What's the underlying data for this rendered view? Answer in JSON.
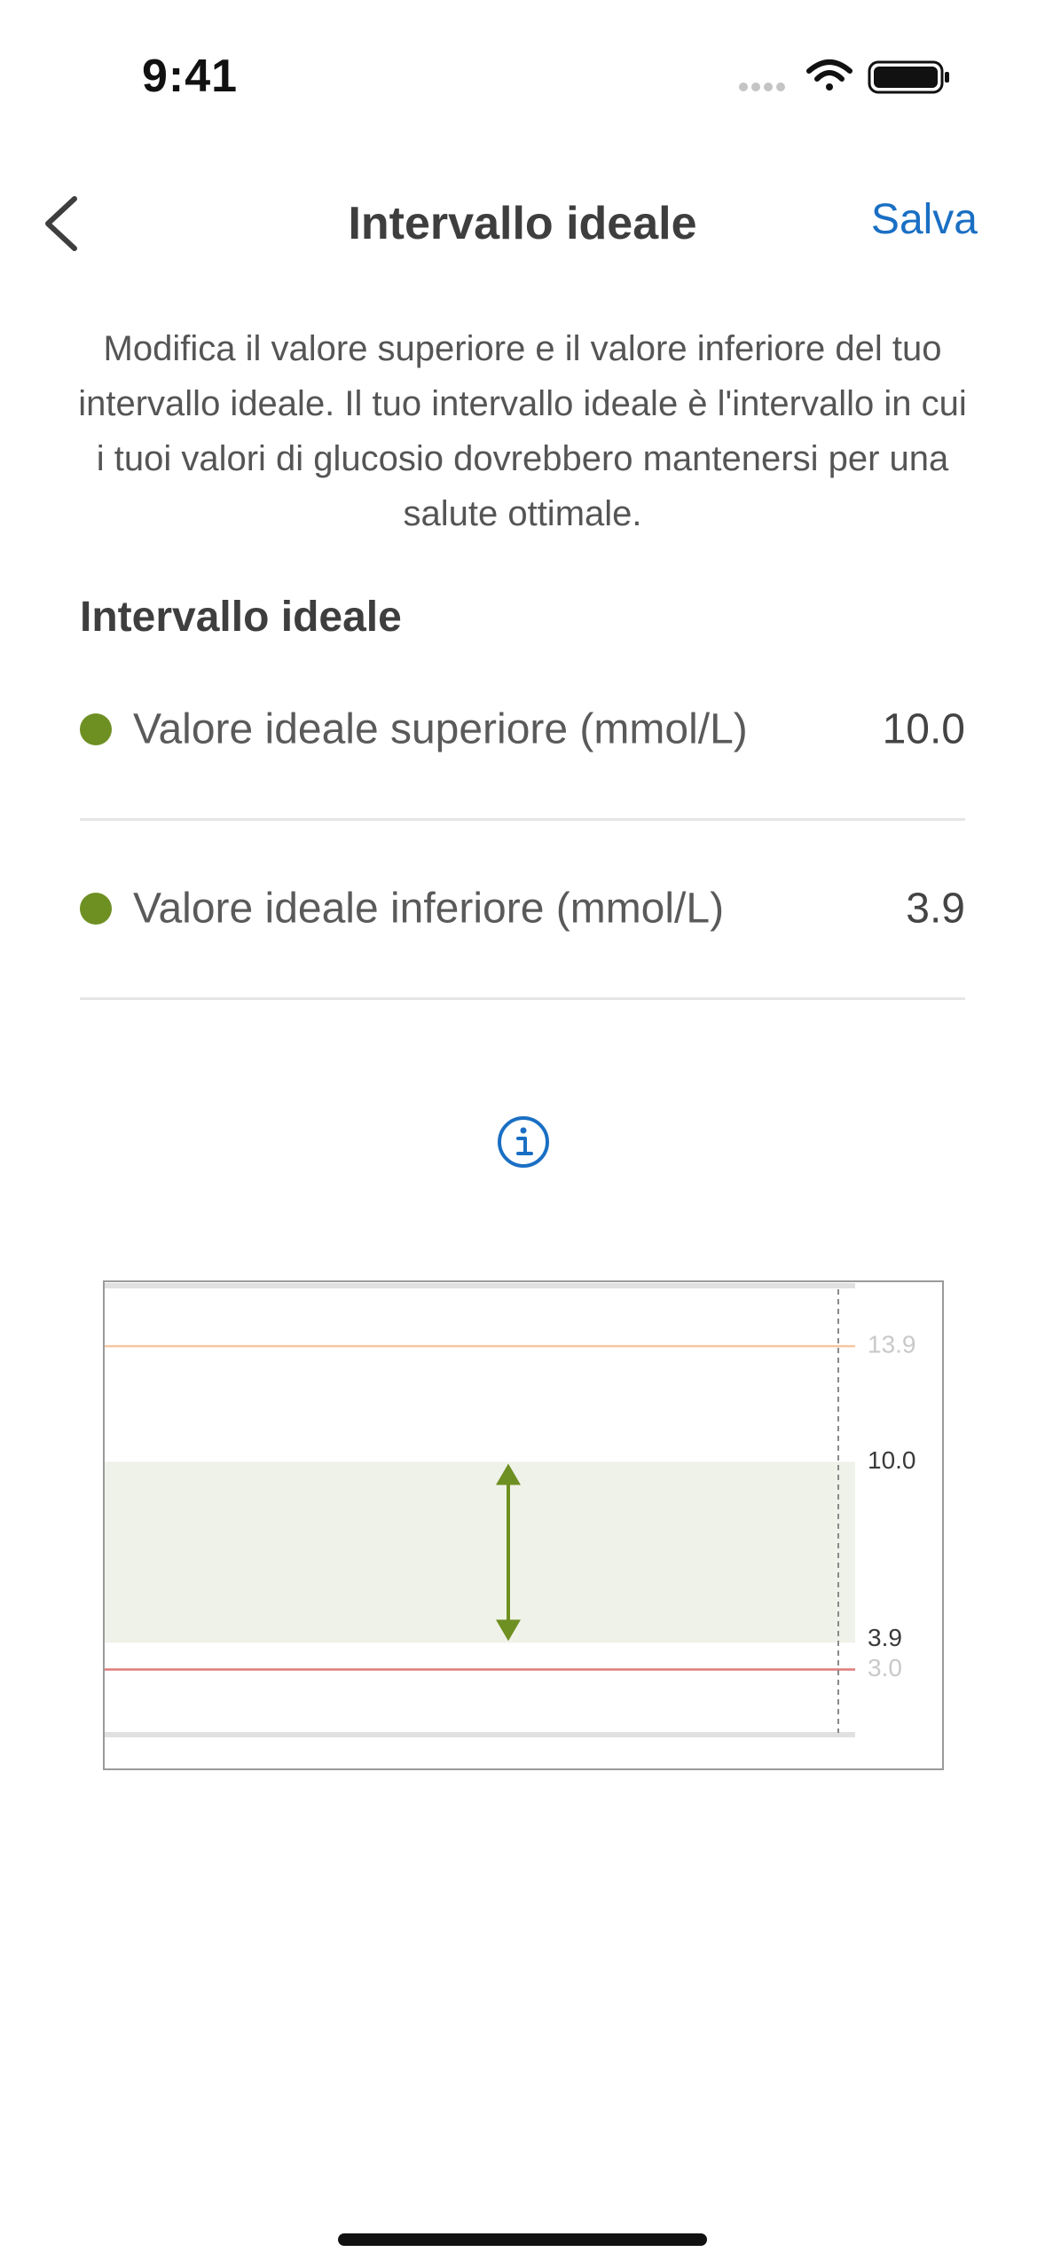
{
  "status_bar": {
    "time": "9:41"
  },
  "nav": {
    "title": "Intervallo ideale",
    "save_label": "Salva",
    "back_icon": "chevron-left-icon"
  },
  "description": "Modifica il valore superiore e il valore inferiore del tuo intervallo ideale. Il tuo intervallo ideale è l'intervallo in cui i tuoi valori di glucosio dovrebbero mantenersi per una salute ottimale.",
  "section": {
    "title": "Intervallo ideale"
  },
  "settings": [
    {
      "label": "Valore ideale superiore (mmol/L)",
      "value": "10.0"
    },
    {
      "label": "Valore ideale inferiore (mmol/L)",
      "value": "3.9"
    }
  ],
  "info_icon": "info-circle-icon",
  "colors": {
    "accent": "#1a6fc4",
    "dot": "#6e8f22",
    "band": "#eff2e8",
    "arrow": "#6e8f22",
    "high_line": "#f6c7a0",
    "low_line": "#e07b7b"
  },
  "chart_data": {
    "type": "range",
    "y_min": 0.8,
    "y_max": 16.0,
    "lines": [
      {
        "value": 13.9,
        "label": "13.9",
        "color": "#f6c7a0",
        "label_color": "#c9c9c9"
      },
      {
        "value": 3.0,
        "label": "3.0",
        "color": "#e07b7b",
        "label_color": "#c9c9c9"
      }
    ],
    "band": {
      "high": 10.0,
      "low": 3.9,
      "high_label": "10.0",
      "low_label": "3.9"
    }
  }
}
